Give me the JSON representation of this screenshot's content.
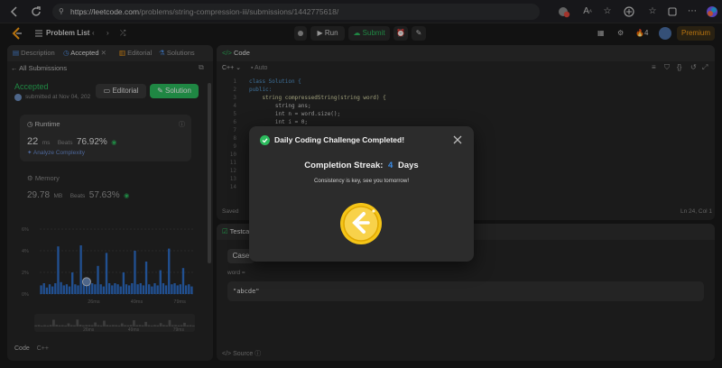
{
  "browser": {
    "url_domain": "https://leetcode.com",
    "url_path": "/problems/string-compression-iii/submissions/1442775618/",
    "icons": [
      "back-icon",
      "refresh-icon",
      "info-icon",
      "extension-icon",
      "read-aloud-icon",
      "star-icon",
      "extensions-icon",
      "favorites-icon",
      "profile-icon",
      "more-icon",
      "copilot-icon"
    ]
  },
  "app_bar": {
    "problem_list": "Problem List",
    "run": "Run",
    "submit": "Submit",
    "streak_count": "4",
    "premium": "Premium"
  },
  "left_panel": {
    "tabs": [
      "Description",
      "Accepted",
      "Editorial",
      "Solutions"
    ],
    "all_submissions": "All Submissions",
    "status": "Accepted",
    "submitted_at": "submitted at Nov 04, 202",
    "editorial_btn": "Editorial",
    "solution_btn": "Solution",
    "runtime": {
      "label": "Runtime",
      "value": "22",
      "unit": "ms",
      "beats_label": "Beats",
      "beats": "76.92%",
      "analyze": "Analyze Complexity"
    },
    "memory": {
      "label": "Memory",
      "value": "29.78",
      "unit": "MB",
      "beats_label": "Beats",
      "beats": "57.63%"
    },
    "chart_y_ticks": [
      "6%",
      "4%",
      "2%",
      "0%"
    ],
    "chart_x_ticks": [
      "26ms",
      "49ms",
      "79ms"
    ],
    "mini_x_ticks": [
      "26ms",
      "49ms",
      "79ms"
    ],
    "code_label": "Code",
    "lang": "C++"
  },
  "chart_data": {
    "type": "bar",
    "xlabel": "",
    "ylabel": "",
    "ylim": [
      0,
      7
    ],
    "x_ticks": [
      "26ms",
      "49ms",
      "79ms"
    ],
    "y_ticks": [
      "6%",
      "4%",
      "2%",
      "0%"
    ],
    "values": [
      0.8,
      1.0,
      0.6,
      0.9,
      0.7,
      1.0,
      4.4,
      1.1,
      0.8,
      0.9,
      0.7,
      2.0,
      0.9,
      0.8,
      4.5,
      1.2,
      0.8,
      1.0,
      1.0,
      0.9,
      2.6,
      0.9,
      0.7,
      3.8,
      1.0,
      0.8,
      1.0,
      0.9,
      0.7,
      2.0,
      0.9,
      0.8,
      1.0,
      4.0,
      0.9,
      1.0,
      0.8,
      3.0,
      0.9,
      0.7,
      1.0,
      0.8,
      2.2,
      1.0,
      0.8,
      4.2,
      0.9,
      1.0,
      0.8,
      0.9,
      2.4,
      0.8,
      0.9,
      0.7
    ],
    "highlight_index": 16
  },
  "code_panel": {
    "title": "Code",
    "lang": "C++",
    "mode": "Auto",
    "lines": [
      {
        "n": "1",
        "code": "class Solution {"
      },
      {
        "n": "2",
        "code": "public:"
      },
      {
        "n": "3",
        "code": "    string compressedString(string word) {"
      },
      {
        "n": "4",
        "code": "        string ans;"
      },
      {
        "n": "5",
        "code": "        int n = word.size();"
      },
      {
        "n": "6",
        "code": "        int i = 0;"
      },
      {
        "n": "7",
        "code": ""
      },
      {
        "n": "8",
        "code": ""
      },
      {
        "n": "9",
        "code": ""
      },
      {
        "n": "10",
        "code": ""
      },
      {
        "n": "11",
        "code": ""
      },
      {
        "n": "12",
        "code": ""
      },
      {
        "n": "13",
        "code": ""
      },
      {
        "n": "14",
        "code": ""
      }
    ],
    "saved": "Saved",
    "cursor": "Ln 24, Col 1"
  },
  "test_panel": {
    "tab": "Testca",
    "case": "Case",
    "input_label": "word =",
    "input_value": "\"abcde\"",
    "source": "Source"
  },
  "modal": {
    "title": "Daily Coding Challenge Completed!",
    "streak_label": "Completion Streak:",
    "streak_days": "4",
    "streak_unit": "Days",
    "message": "Consistency is key, see you tomorrow!",
    "check_color": "#2cbb5d",
    "accent": "#3b8de8",
    "coin_color": "#f5c518"
  }
}
